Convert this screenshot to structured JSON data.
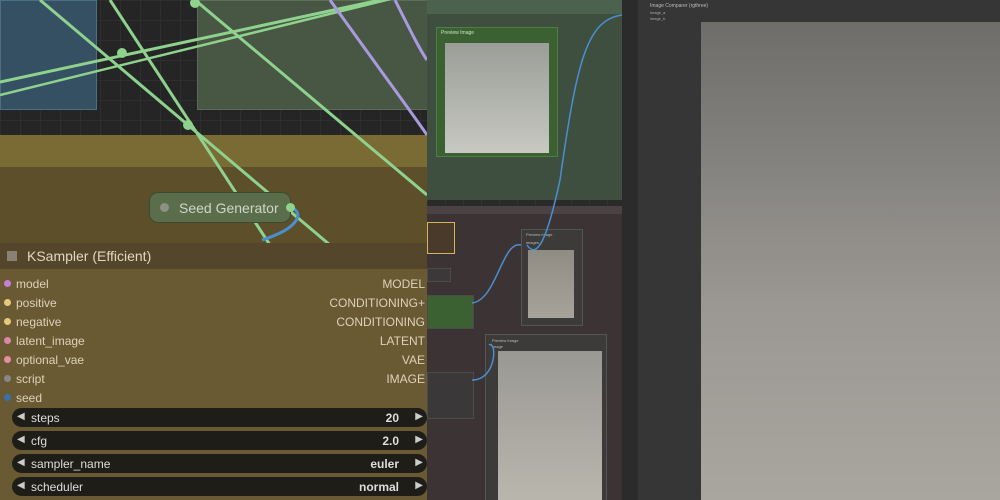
{
  "left_canvas": {
    "seed_node": {
      "label": "Seed Generator"
    },
    "ksampler": {
      "title": "KSampler (Efficient)",
      "inputs": [
        {
          "name": "model",
          "type": "MODEL",
          "color": "#c47fd6"
        },
        {
          "name": "positive",
          "type": "CONDITIONING+",
          "color": "#e8c87a"
        },
        {
          "name": "negative",
          "type": "CONDITIONING",
          "color": "#e8c87a"
        },
        {
          "name": "latent_image",
          "type": "LATENT",
          "color": "#d98aa8"
        },
        {
          "name": "optional_vae",
          "type": "VAE",
          "color": "#e58fa0"
        },
        {
          "name": "script",
          "type": "IMAGE",
          "color": "#888888"
        },
        {
          "name": "seed",
          "type": "",
          "color": "#3a6fb0"
        }
      ],
      "widgets": [
        {
          "name": "steps",
          "value": "20"
        },
        {
          "name": "cfg",
          "value": "2.0"
        },
        {
          "name": "sampler_name",
          "value": "euler"
        },
        {
          "name": "scheduler",
          "value": "normal"
        }
      ]
    }
  },
  "middle_canvas": {
    "preview_node_title": "Preview Image",
    "preview_node2_title": "Preview Image",
    "preview_node3_title": "Preview Image",
    "image_label": "image",
    "small_inputs": [
      "images",
      "image"
    ]
  },
  "right_canvas": {
    "compare_node_title": "Image Comparer (rgthree)",
    "inputs": [
      "image_a",
      "image_b"
    ]
  },
  "colors": {
    "wire_green": "#8ed28e",
    "wire_purple": "#a99ae0",
    "wire_blue": "#4a8fd0"
  }
}
